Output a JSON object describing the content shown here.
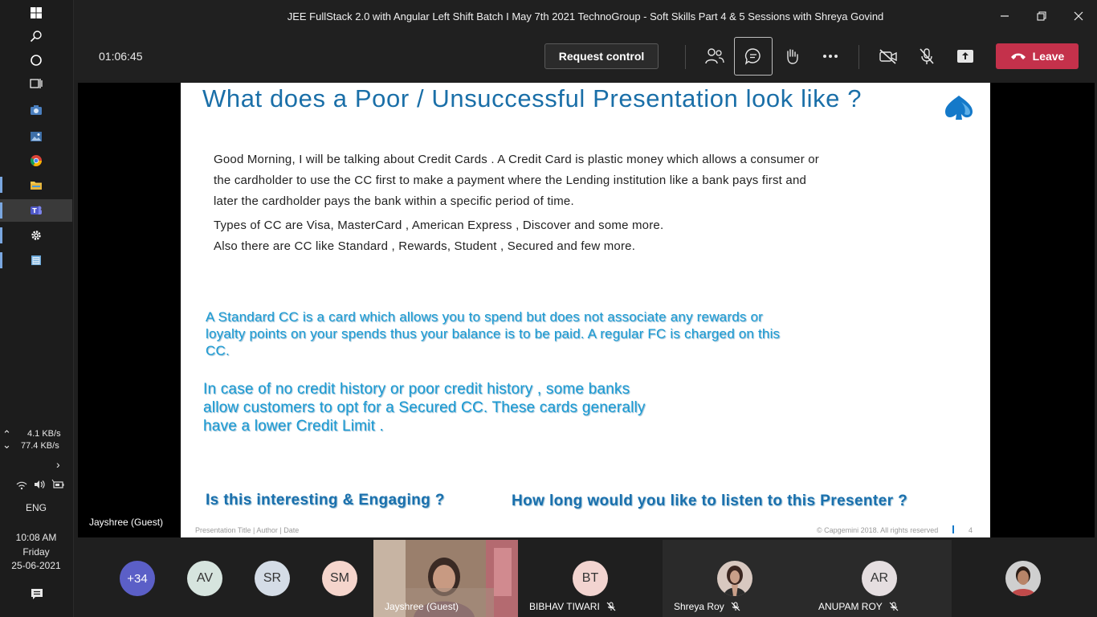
{
  "window": {
    "title": "JEE FullStack 2.0 with Angular Left Shift Batch I May 7th 2021 TechnoGroup - Soft Skills Part 4 & 5 Sessions with Shreya Govind"
  },
  "meeting": {
    "timer": "01:06:45",
    "request_control_label": "Request control",
    "leave_label": "Leave",
    "presenter_name": "Jayshree (Guest)"
  },
  "slide": {
    "title": "What does a Poor / Unsuccessful Presentation look like ?",
    "paragraph1": "Good Morning, I will be talking about Credit Cards . A Credit Card is plastic money which allows a consumer or the cardholder to use the CC first to make a payment where the Lending institution like a bank pays first and later the cardholder pays the bank within a specific period of time.",
    "paragraph2_line1": "Types of CC are Visa, MasterCard , American Express , Discover and some more.",
    "paragraph2_line2": "Also there are CC like Standard , Rewards, Student , Secured and few more.",
    "blue1": "A Standard CC is a card which allows you to spend but does not associate any rewards or loyalty points on your spends thus your balance is to be paid. A regular FC is charged on this CC.",
    "blue2": "In case of no credit history or poor credit history , some banks allow customers to opt for a Secured CC. These cards generally have a lower Credit Limit .",
    "question1": "Is this interesting & Engaging ?",
    "question2": "How long would you like to listen to this Presenter ?",
    "footer_left": "Presentation Title | Author | Date",
    "footer_right": "© Capgemini 2018. All rights reserved",
    "page_number": "4"
  },
  "taskbar": {
    "net_up": "4.1 KB/s",
    "net_down": "77.4 KB/s",
    "language": "ENG",
    "time": "10:08 AM",
    "day": "Friday",
    "date": "25-06-2021"
  },
  "participants": {
    "overflow": "+34",
    "av": "AV",
    "sr": "SR",
    "sm": "SM",
    "video_name": "Jayshree (Guest)",
    "bt_initials": "BT",
    "bt_name": "BIBHAV TIWARI",
    "shreya_name": "Shreya Roy",
    "ar_initials": "AR",
    "ar_name": "ANUPAM ROY"
  },
  "colors": {
    "leave": "#c4314b",
    "slide_title": "#1a6fa8",
    "slide_blue": "#1a9ad3",
    "overflow_avatar": "#5b5fc7"
  }
}
